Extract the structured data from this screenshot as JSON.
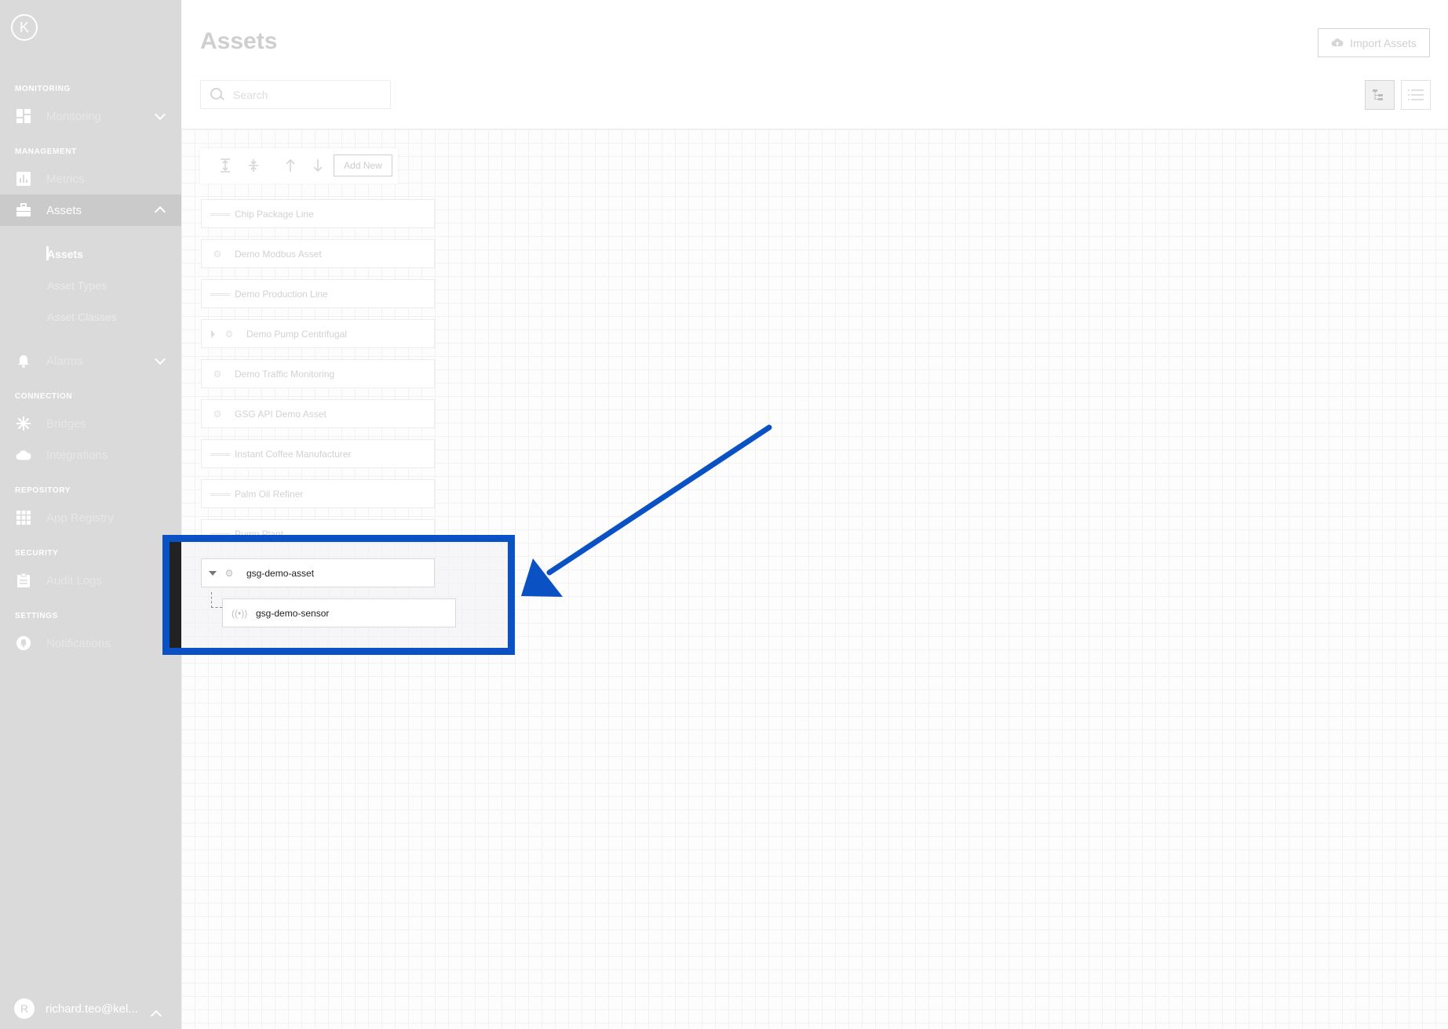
{
  "logo": {
    "letter": "K"
  },
  "sidebar": {
    "sections": [
      "MONITORING",
      "MANAGEMENT",
      "CONNECTION",
      "REPOSITORY",
      "SECURITY",
      "SETTINGS"
    ],
    "items": [
      {
        "label": "Monitoring",
        "icon": "dashboard-icon"
      },
      {
        "label": "Metrics",
        "icon": "chart-icon"
      },
      {
        "label": "Assets",
        "icon": "briefcase-icon"
      },
      {
        "label": "Alarms",
        "icon": "bell-icon"
      },
      {
        "label": "Bridges",
        "icon": "bridge-icon"
      },
      {
        "label": "Integrations",
        "icon": "cloud-icon"
      },
      {
        "label": "App Registry",
        "icon": "grid-icon"
      },
      {
        "label": "Audit Logs",
        "icon": "clipboard-icon"
      },
      {
        "label": "Notifications",
        "icon": "notification-icon"
      }
    ],
    "sub_items": [
      "Assets",
      "Asset Types",
      "Asset Classes"
    ],
    "user": {
      "initial": "R",
      "name": "richard.teo@kel..."
    }
  },
  "header": {
    "title": "Assets",
    "import_label": "Import Assets",
    "search_placeholder": "Search"
  },
  "toolbar": {
    "add_label": "Add New"
  },
  "assets": [
    "Chip Package Line",
    "Demo Modbus Asset",
    "Demo Production Line",
    "Demo Pump Centrifugal",
    "Demo Traffic Monitoring",
    "GSG API Demo Asset",
    "Instant Coffee Manufacturer",
    "Palm Oil Refiner",
    "Pump Plant"
  ],
  "focus": {
    "parent": "gsg-demo-asset",
    "child": "gsg-demo-sensor"
  },
  "colors": {
    "highlight": "#0a52c4",
    "sidebar": "#d9dad9"
  }
}
